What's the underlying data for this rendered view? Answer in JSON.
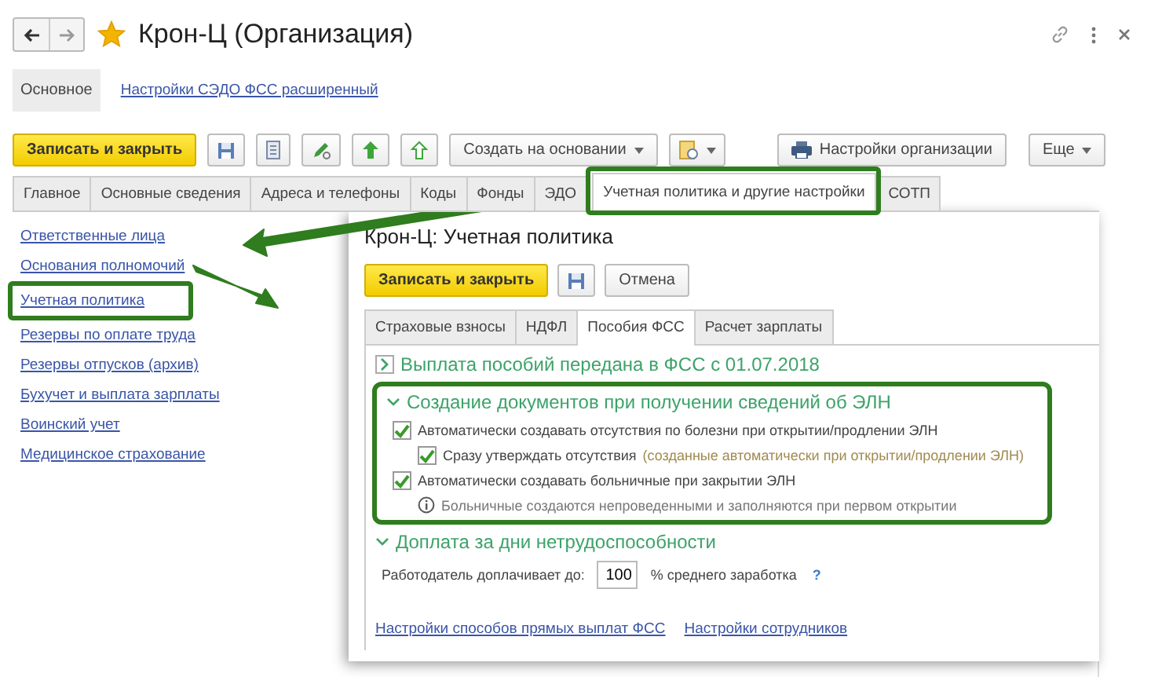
{
  "window": {
    "title": "Крон-Ц (Организация)",
    "favorite": true
  },
  "nav": [
    {
      "label": "Основное",
      "selected": true
    },
    {
      "label": "Настройки СЭДО ФСС расширенный",
      "selected": false
    }
  ],
  "toolbar": {
    "primary": "Записать и закрыть",
    "create_based_on": "Создать на основании",
    "settings": "Настройки организации",
    "more": "Еще"
  },
  "tabs": [
    {
      "label": "Главное",
      "selected": false,
      "highlighted": false
    },
    {
      "label": "Основные сведения",
      "selected": false,
      "highlighted": false
    },
    {
      "label": "Адреса и телефоны",
      "selected": false,
      "highlighted": false
    },
    {
      "label": "Коды",
      "selected": false,
      "highlighted": false
    },
    {
      "label": "Фонды",
      "selected": false,
      "highlighted": false
    },
    {
      "label": "ЭДО",
      "selected": false,
      "highlighted": false
    },
    {
      "label": "Учетная политика и другие настройки",
      "selected": true,
      "highlighted": true
    },
    {
      "label": "СОТП",
      "selected": false,
      "highlighted": false
    }
  ],
  "links": [
    {
      "label": "Ответственные лица",
      "highlighted": false
    },
    {
      "label": "Основания полномочий",
      "highlighted": false
    },
    {
      "label": "Учетная политика",
      "highlighted": true
    },
    {
      "label": "Резервы по оплате труда",
      "highlighted": false
    },
    {
      "label": "Резервы отпусков (архив)",
      "highlighted": false
    },
    {
      "label": "Бухучет и выплата зарплаты",
      "highlighted": false
    },
    {
      "label": "Воинский учет",
      "highlighted": false
    },
    {
      "label": "Медицинское страхование",
      "highlighted": false
    }
  ],
  "dialog": {
    "title": "Крон-Ц: Учетная политика",
    "primary": "Записать и закрыть",
    "cancel": "Отмена",
    "tabs": [
      {
        "label": "Страховые взносы",
        "selected": false
      },
      {
        "label": "НДФЛ",
        "selected": false
      },
      {
        "label": "Пособия ФСС",
        "selected": true
      },
      {
        "label": "Расчет зарплаты",
        "selected": false
      }
    ],
    "sections": [
      {
        "title": "Выплата пособий передана в ФСС с 01.07.2018",
        "expanded": false,
        "highlighted": false
      },
      {
        "title": "Создание документов при получении сведений об ЭЛН",
        "expanded": true,
        "highlighted": true,
        "items": [
          {
            "kind": "checkbox",
            "label": "Автоматически создавать отсутствия по болезни при открытии/продлении ЭЛН",
            "checked": true,
            "children": [
              {
                "kind": "checkbox",
                "label": "Сразу утверждать отсутствия",
                "note": "(созданные автоматически при открытии/продлении ЭЛН)",
                "checked": true
              }
            ]
          },
          {
            "kind": "checkbox",
            "label": "Автоматически создавать больничные при закрытии ЭЛН",
            "checked": true
          },
          {
            "kind": "info",
            "label": "Больничные создаются непроведенными и заполняются при первом открытии"
          }
        ]
      },
      {
        "title": "Доплата за дни нетрудоспособности",
        "expanded": true,
        "highlighted": false,
        "items": [
          {
            "kind": "number",
            "label": "Работодатель доплачивает до:",
            "value": "100",
            "suffix": "% среднего заработка",
            "help": "?"
          }
        ]
      }
    ],
    "links": [
      "Настройки способов прямых выплат ФСС",
      "Настройки сотрудников"
    ]
  }
}
